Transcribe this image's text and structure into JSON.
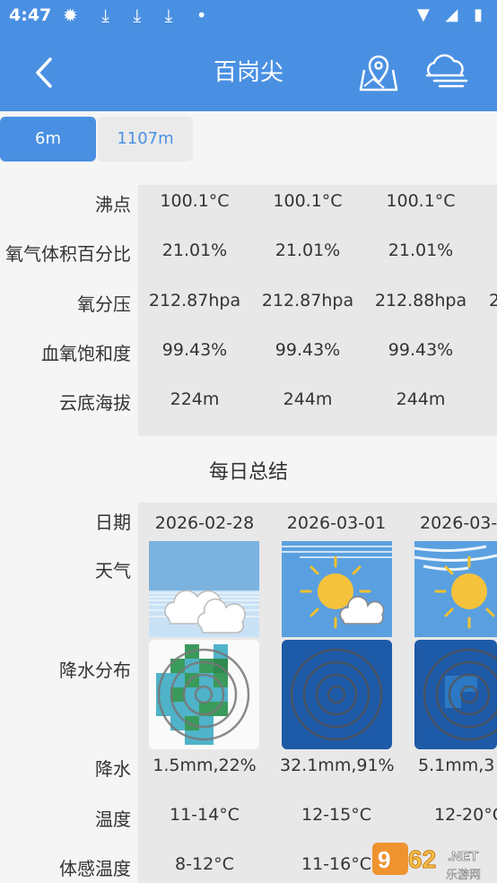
{
  "status_bar": {
    "time": "4:47",
    "notifications": "✹ ⤓ ⤓ ⤓ •",
    "system_icons": "▼ ◢ ▮"
  },
  "app_bar": {
    "title": "百岗尖",
    "back_icon": "chevron-left-icon",
    "map_icon": "map-pin-icon",
    "weather_icon": "cloud-wind-icon"
  },
  "tabs": [
    {
      "label": "6m",
      "active": true
    },
    {
      "label": "1107m",
      "active": false
    }
  ],
  "metrics": {
    "labels": [
      "沸点",
      "氧气体积百分比",
      "氧分压",
      "血氧饱和度",
      "云底海拔"
    ],
    "rows": [
      [
        "100.1°C",
        "100.1°C",
        "100.1°C"
      ],
      [
        "21.01%",
        "21.01%",
        "21.01%"
      ],
      [
        "212.87hpa",
        "212.87hpa",
        "212.88hpa",
        "2"
      ],
      [
        "99.43%",
        "99.43%",
        "99.43%"
      ],
      [
        "224m",
        "244m",
        "244m"
      ]
    ]
  },
  "daily_summary": {
    "title": "每日总结",
    "labels": {
      "date": "日期",
      "weather": "天气",
      "precip_map": "降水分布",
      "precip": "降水",
      "temp": "温度",
      "feels_like": "体感温度"
    },
    "days": [
      {
        "date": "2026-02-28",
        "weather": "cloudy",
        "precip": "1.5mm,22%",
        "temp": "11-14°C",
        "feels_like": "8-12°C"
      },
      {
        "date": "2026-03-01",
        "weather": "partly-sunny",
        "precip": "32.1mm,91%",
        "temp": "12-15°C",
        "feels_like": "11-16°C"
      },
      {
        "date": "2026-03-",
        "weather": "sunny-windy",
        "precip": "5.1mm,3",
        "temp": "12-20°C",
        "feels_like": ""
      }
    ]
  },
  "watermark": {
    "text": "962",
    "suffix": ".NET",
    "sub": "乐游网"
  }
}
